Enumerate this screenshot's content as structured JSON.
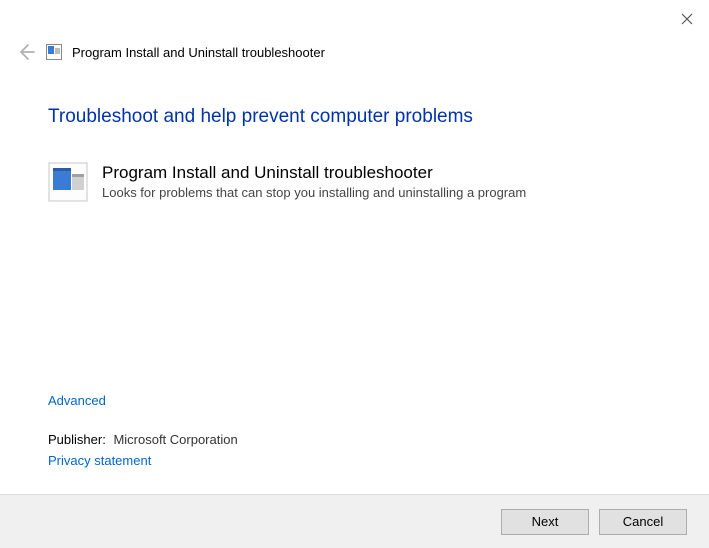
{
  "window": {
    "title": "Program Install and Uninstall troubleshooter"
  },
  "main": {
    "heading": "Troubleshoot and help prevent computer problems",
    "item": {
      "title": "Program Install and Uninstall troubleshooter",
      "description": "Looks for problems that can stop you installing and uninstalling a program"
    }
  },
  "links": {
    "advanced": "Advanced",
    "privacy": "Privacy statement"
  },
  "publisher": {
    "label": "Publisher:",
    "value": "Microsoft Corporation"
  },
  "buttons": {
    "next": "Next",
    "cancel": "Cancel"
  },
  "icons": {
    "close": "close-icon",
    "back": "back-arrow-icon",
    "app_small": "troubleshooter-icon-small",
    "app_large": "troubleshooter-icon-large"
  }
}
